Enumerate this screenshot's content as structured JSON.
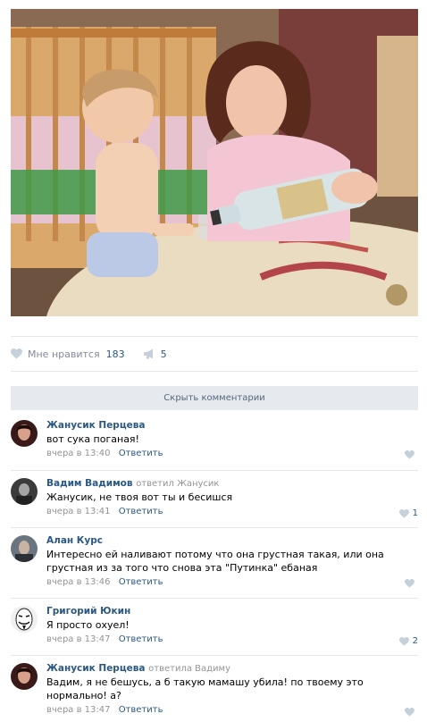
{
  "post": {
    "likes_label": "Мне нравится",
    "likes_count": "183",
    "shares_count": "5"
  },
  "comments_toggle": "Скрыть комментарии",
  "comments": [
    {
      "author": "Жанусик Перцева",
      "reply_to": "",
      "text": "вот сука поганая!",
      "time": "вчера в 13:40",
      "reply_label": "Ответить",
      "likes": ""
    },
    {
      "author": "Вадим Вадимов",
      "reply_to": "ответил Жанусик",
      "text": "Жанусик, не твоя вот ты и бесишся",
      "time": "вчера в 13:41",
      "reply_label": "Ответить",
      "likes": "1"
    },
    {
      "author": "Алан Курс",
      "reply_to": "",
      "text": "Интересно ей наливают потому что она грустная такая, или она грустная из за того что снова эта \"Путинка\" ебаная",
      "time": "вчера в 13:46",
      "reply_label": "Ответить",
      "likes": ""
    },
    {
      "author": "Григорий Юкин",
      "reply_to": "",
      "text": "Я просто охуел!",
      "time": "вчера в 13:47",
      "reply_label": "Ответить",
      "likes": "2"
    },
    {
      "author": "Жанусик Перцева",
      "reply_to": "ответила Вадиму",
      "text": "Вадим, я не бешусь, а б такую мамашу убила! по твоему это нормально! а?",
      "time": "вчера в 13:47",
      "reply_label": "Ответить",
      "likes": ""
    }
  ],
  "colors": {
    "link": "#2a5885",
    "muted": "#939393",
    "heart": "#c5d0db"
  }
}
